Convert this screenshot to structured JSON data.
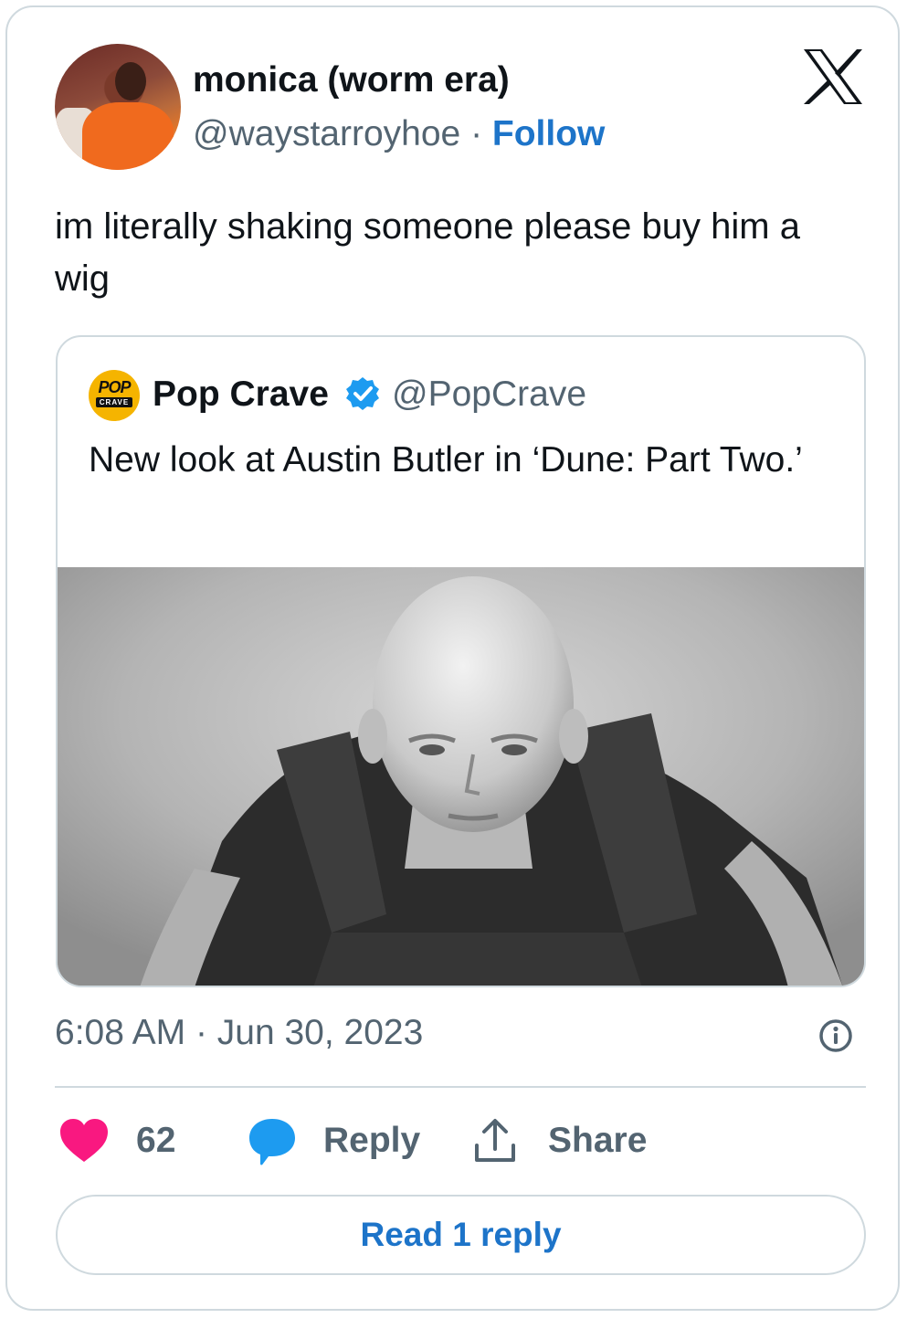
{
  "author": {
    "display_name": "monica (worm era)",
    "handle": "@waystarroyhoe",
    "separator": "·",
    "follow_label": "Follow"
  },
  "tweet": {
    "text": "im literally shaking someone please buy him a wig",
    "time": "6:08 AM",
    "date": "Jun 30, 2023",
    "separator": "·"
  },
  "quoted": {
    "display_name": "Pop Crave",
    "handle": "@PopCrave",
    "verified": true,
    "text": "New look at Austin Butler in ‘Dune: Part Two.’",
    "logo_text_top": "POP",
    "logo_text_bottom": "CRAVE",
    "photo_icon": "photo-bald-man-icon"
  },
  "actions": {
    "like_count": "62",
    "reply_label": "Reply",
    "share_label": "Share"
  },
  "read_replies_label": "Read 1 reply",
  "colors": {
    "accent": "#1d74c9",
    "like": "#f91880",
    "reply_icon": "#1d9bf0",
    "muted": "#536471",
    "border": "#cfd9de",
    "text": "#0f1419",
    "verified": "#1d9bf0"
  },
  "icons": {
    "brand": "x-logo-icon",
    "info": "info-icon",
    "like": "heart-icon",
    "reply": "speech-bubble-icon",
    "share": "upload-share-icon",
    "verified": "verified-badge-icon"
  }
}
